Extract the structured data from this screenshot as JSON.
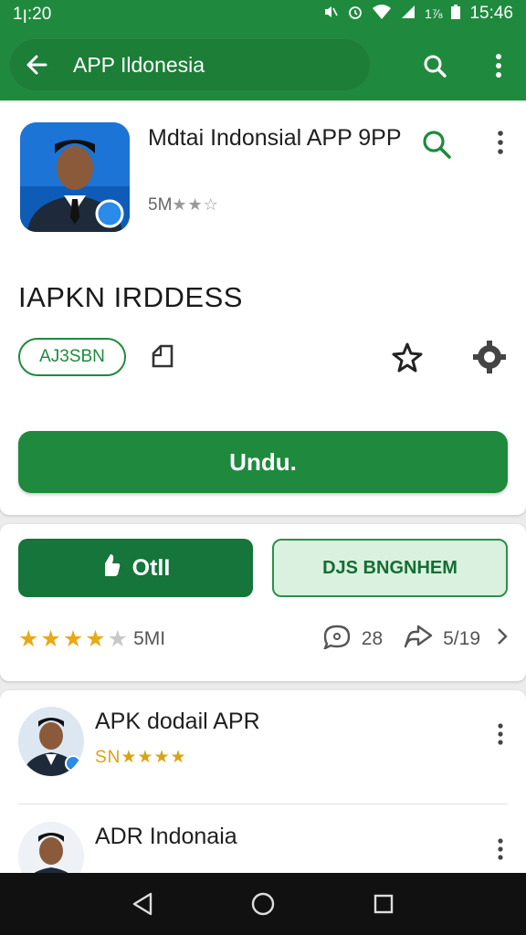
{
  "status_bar": {
    "time": "1ꞁ:20",
    "battery_text": "1⅞",
    "clock_right": "15:46",
    "icons": [
      "mute-icon",
      "alarm-icon",
      "wifi-icon",
      "signal-icon",
      "battery-icon"
    ]
  },
  "app_bar": {
    "title": "APP Ildonesia",
    "icons": [
      "back-arrow-icon",
      "search-icon",
      "more-vert-icon"
    ]
  },
  "app_header": {
    "name": "Mdtai Indonsial APP 9PP",
    "size": "5M",
    "stars": "★★☆"
  },
  "section": {
    "heading": "IAPKN IRDDESS",
    "chip_label": "AJ3SBN"
  },
  "install_button": "Undu.",
  "actions": {
    "primary_label": "OtlI",
    "secondary_label": "DJS BNGNHEM"
  },
  "rating": {
    "stars": "★★★★",
    "count": "5MI",
    "comments": "28",
    "shares": "5/19"
  },
  "related": [
    {
      "name": "APK dodail APR",
      "meta": "SN★★★★"
    },
    {
      "name": "ADR Indonaia",
      "meta": ""
    }
  ],
  "colors": {
    "brand_green": "#1f8a3d",
    "star_gold": "#e9a916",
    "nav_bg": "#111111"
  }
}
